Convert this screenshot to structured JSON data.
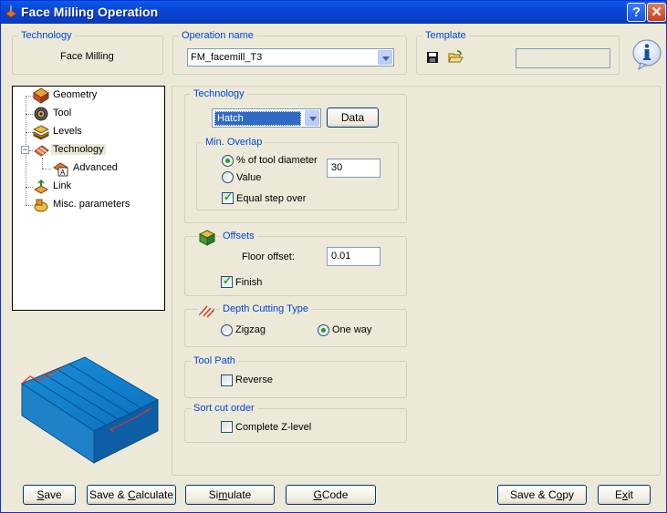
{
  "window": {
    "title": "Face Milling Operation",
    "help_glyph": "?",
    "close_glyph": "✕"
  },
  "header": {
    "technology_legend": "Technology",
    "technology_value": "Face Milling",
    "operation_name_legend": "Operation name",
    "operation_name_value": "FM_facemill_T3",
    "template_legend": "Template",
    "template_value": ""
  },
  "tree": {
    "items": [
      {
        "label": "Geometry",
        "icon": "geometry-icon"
      },
      {
        "label": "Tool",
        "icon": "tool-icon"
      },
      {
        "label": "Levels",
        "icon": "levels-icon"
      },
      {
        "label": "Technology",
        "icon": "technology-icon"
      },
      {
        "label": "Advanced",
        "icon": "advanced-icon"
      },
      {
        "label": "Link",
        "icon": "link-icon"
      },
      {
        "label": "Misc. parameters",
        "icon": "misc-parameters-icon"
      }
    ],
    "selected": "Technology"
  },
  "technology": {
    "legend": "Technology",
    "strategy_value": "Hatch",
    "data_button": "Data",
    "min_overlap": {
      "legend": "Min. Overlap",
      "option_percent": "% of tool diameter",
      "option_value": "Value",
      "selected": "% of tool diameter",
      "value": "30",
      "equal_step_over_label": "Equal step over",
      "equal_step_over_checked": true
    }
  },
  "offsets": {
    "legend": "Offsets",
    "floor_offset_label": "Floor offset:",
    "floor_offset_value": "0.01",
    "finish_label": "Finish",
    "finish_checked": true
  },
  "depth_cutting": {
    "legend": "Depth Cutting Type",
    "option_zigzag": "Zigzag",
    "option_one_way": "One way",
    "selected": "One way"
  },
  "tool_path": {
    "legend": "Tool Path",
    "reverse_label": "Reverse",
    "reverse_checked": false
  },
  "sort_cut_order": {
    "legend": "Sort cut order",
    "complete_z_level_label": "Complete Z-level",
    "complete_z_level_checked": false
  },
  "buttons": {
    "save_u": "S",
    "save_rest": "ave",
    "save_calc_pre": "Save & ",
    "save_calc_u": "C",
    "save_calc_rest": "alculate",
    "simulate_pre": "Si",
    "simulate_u": "m",
    "simulate_rest": "ulate",
    "gcode_u": "G",
    "gcode_rest": "Code",
    "save_copy_pre": "Save & C",
    "save_copy_u": "o",
    "save_copy_rest": "py",
    "exit_pre": "E",
    "exit_u": "x",
    "exit_rest": "it"
  },
  "colors": {
    "titlebar": "#0a46d8",
    "legend_text": "#0046d5",
    "selection": "#316ac5"
  }
}
